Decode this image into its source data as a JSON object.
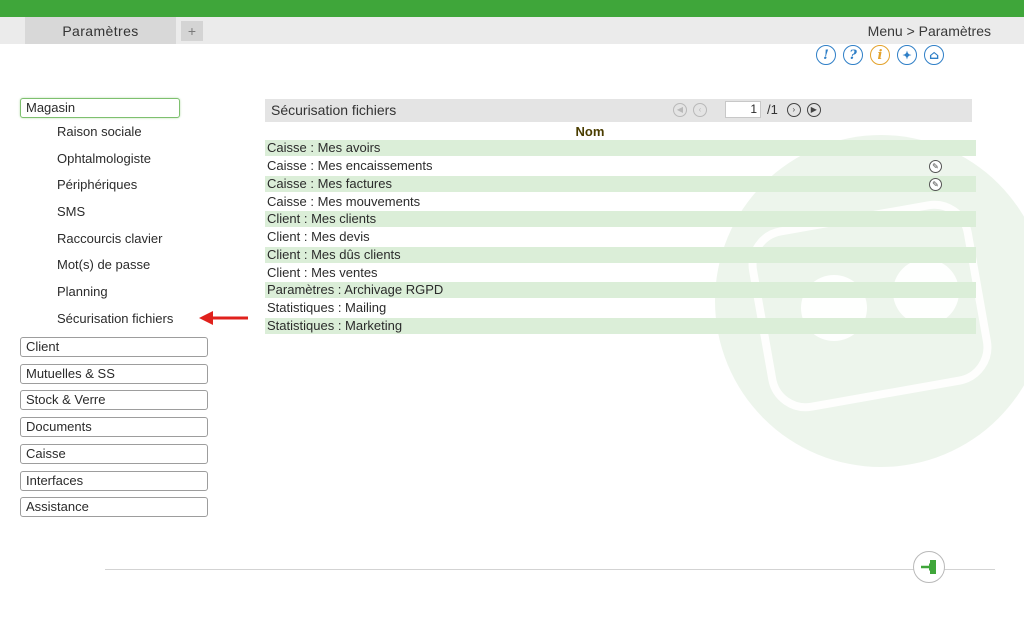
{
  "tabs": {
    "active_label": "Paramètres",
    "add_label": "+"
  },
  "breadcrumb": "Menu > Paramètres",
  "header_icons": [
    "alert-icon",
    "help-icon",
    "info-icon",
    "tools-icon",
    "home-icon"
  ],
  "header_icon_glyphs": [
    "!",
    "?",
    "i",
    "✦",
    "⌂"
  ],
  "sidebar": {
    "active_category": "Magasin",
    "sub_items": [
      "Raison sociale",
      "Ophtalmologiste",
      "Périphériques",
      "SMS",
      "Raccourcis clavier",
      "Mot(s) de passe",
      "Planning",
      "Sécurisation fichiers"
    ],
    "categories": [
      "Client",
      "Mutuelles & SS",
      "Stock & Verre",
      "Documents",
      "Caisse",
      "Interfaces",
      "Assistance"
    ]
  },
  "panel": {
    "title": "Sécurisation fichiers",
    "current_page": "1",
    "total_pages": "/1",
    "column_header": "Nom",
    "rows": [
      "Caisse : Mes avoirs",
      "Caisse : Mes encaissements",
      "Caisse : Mes factures",
      "Caisse : Mes mouvements",
      "Client : Mes clients",
      "Client : Mes devis",
      "Client : Mes dûs clients",
      "Client : Mes ventes",
      "Paramètres : Archivage RGPD",
      "Statistiques : Mailing",
      "Statistiques : Marketing"
    ]
  },
  "colors": {
    "top_bar": "#3fa63a",
    "row_shade": "#dbeed8",
    "annotation_arrow": "#e0211c",
    "help_icon": "#2f7fc7",
    "info_icon": "#e3a22b"
  }
}
